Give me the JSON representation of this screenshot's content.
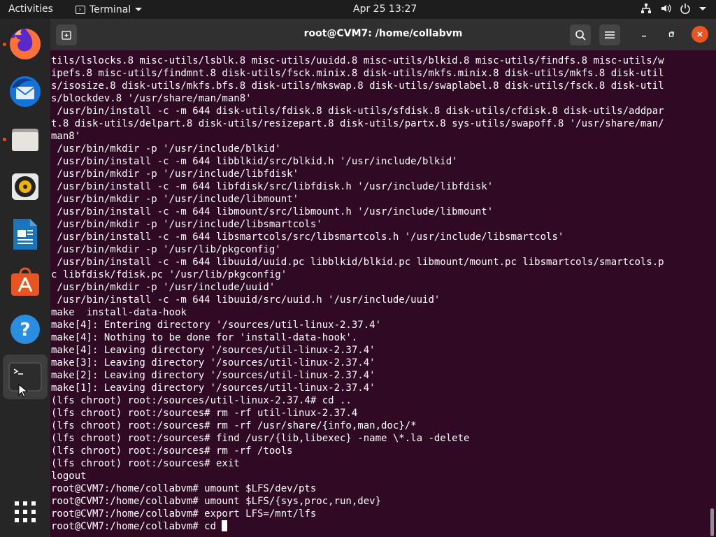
{
  "topbar": {
    "activities": "Activities",
    "app_name": "Terminal",
    "clock": "Apr 25  13:27"
  },
  "dock": {
    "items": [
      {
        "name": "Firefox",
        "icon": "firefox-icon",
        "running": true
      },
      {
        "name": "Thunderbird",
        "icon": "thunderbird-icon",
        "running": false
      },
      {
        "name": "Files",
        "icon": "files-icon",
        "running": true
      },
      {
        "name": "Rhythmbox",
        "icon": "rhythmbox-icon",
        "running": false
      },
      {
        "name": "LibreOffice Writer",
        "icon": "writer-icon",
        "running": false
      },
      {
        "name": "Ubuntu Software",
        "icon": "software-icon",
        "running": false
      },
      {
        "name": "Help",
        "icon": "help-icon",
        "running": false
      },
      {
        "name": "Terminal",
        "icon": "terminal-icon",
        "running": true,
        "active": true
      },
      {
        "name": "Show Applications",
        "icon": "app-grid-icon",
        "running": false
      }
    ]
  },
  "window": {
    "title": "root@CVM7: /home/collabvm",
    "new_tab_icon": "new-tab-icon",
    "search_icon": "search-icon",
    "menu_icon": "hamburger-icon"
  },
  "terminal": {
    "lines": [
      "tils/lslocks.8 misc-utils/lsblk.8 misc-utils/uuidd.8 misc-utils/blkid.8 misc-utils/findfs.8 misc-utils/w",
      "ipefs.8 misc-utils/findmnt.8 disk-utils/fsck.minix.8 disk-utils/mkfs.minix.8 disk-utils/mkfs.8 disk-util",
      "s/isosize.8 disk-utils/mkfs.bfs.8 disk-utils/mkswap.8 disk-utils/swaplabel.8 disk-utils/fsck.8 disk-util",
      "s/blockdev.8 '/usr/share/man/man8'",
      " /usr/bin/install -c -m 644 disk-utils/fdisk.8 disk-utils/sfdisk.8 disk-utils/cfdisk.8 disk-utils/addpar",
      "t.8 disk-utils/delpart.8 disk-utils/resizepart.8 disk-utils/partx.8 sys-utils/swapoff.8 '/usr/share/man/",
      "man8'",
      " /usr/bin/mkdir -p '/usr/include/blkid'",
      " /usr/bin/install -c -m 644 libblkid/src/blkid.h '/usr/include/blkid'",
      " /usr/bin/mkdir -p '/usr/include/libfdisk'",
      " /usr/bin/install -c -m 644 libfdisk/src/libfdisk.h '/usr/include/libfdisk'",
      " /usr/bin/mkdir -p '/usr/include/libmount'",
      " /usr/bin/install -c -m 644 libmount/src/libmount.h '/usr/include/libmount'",
      " /usr/bin/mkdir -p '/usr/include/libsmartcols'",
      " /usr/bin/install -c -m 644 libsmartcols/src/libsmartcols.h '/usr/include/libsmartcols'",
      " /usr/bin/mkdir -p '/usr/lib/pkgconfig'",
      " /usr/bin/install -c -m 644 libuuid/uuid.pc libblkid/blkid.pc libmount/mount.pc libsmartcols/smartcols.p",
      "c libfdisk/fdisk.pc '/usr/lib/pkgconfig'",
      " /usr/bin/mkdir -p '/usr/include/uuid'",
      " /usr/bin/install -c -m 644 libuuid/src/uuid.h '/usr/include/uuid'",
      "make  install-data-hook",
      "make[4]: Entering directory '/sources/util-linux-2.37.4'",
      "make[4]: Nothing to be done for 'install-data-hook'.",
      "make[4]: Leaving directory '/sources/util-linux-2.37.4'",
      "make[3]: Leaving directory '/sources/util-linux-2.37.4'",
      "make[2]: Leaving directory '/sources/util-linux-2.37.4'",
      "make[1]: Leaving directory '/sources/util-linux-2.37.4'",
      "(lfs chroot) root:/sources/util-linux-2.37.4# cd ..",
      "(lfs chroot) root:/sources# rm -rf util-linux-2.37.4",
      "(lfs chroot) root:/sources# rm -rf /usr/share/{info,man,doc}/*",
      "(lfs chroot) root:/sources# find /usr/{lib,libexec} -name \\*.la -delete",
      "(lfs chroot) root:/sources# rm -rf /tools",
      "(lfs chroot) root:/sources# exit",
      "logout",
      "root@CVM7:/home/collabvm# umount $LFS/dev/pts",
      "root@CVM7:/home/collabvm# umount $LFS/{sys,proc,run,dev}",
      "root@CVM7:/home/collabvm# export LFS=/mnt/lfs"
    ],
    "prompt_line": "root@CVM7:/home/collabvm# cd "
  },
  "colors": {
    "terminal_bg": "#300a24",
    "accent": "#e95420",
    "close_button": "#e95420"
  }
}
